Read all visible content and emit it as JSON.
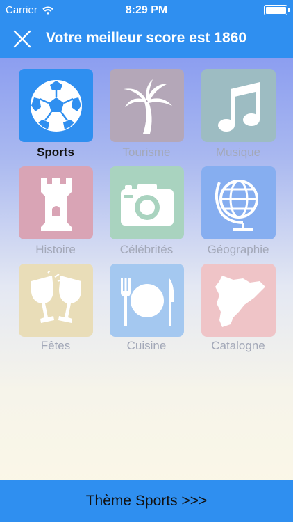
{
  "status_bar": {
    "carrier": "Carrier",
    "time": "8:29 PM"
  },
  "header": {
    "title": "Votre meilleur score est 1860"
  },
  "categories": [
    {
      "label": "Sports",
      "icon": "soccer-ball-icon",
      "color": "#2f8ff0",
      "selected": true
    },
    {
      "label": "Tourisme",
      "icon": "palm-tree-icon",
      "color": "#b4a7b8",
      "selected": false
    },
    {
      "label": "Musique",
      "icon": "music-note-icon",
      "color": "#9dbcc2",
      "selected": false
    },
    {
      "label": "Histoire",
      "icon": "castle-tower-icon",
      "color": "#d9a4b5",
      "selected": false
    },
    {
      "label": "Célébrités",
      "icon": "camera-icon",
      "color": "#a9d3bf",
      "selected": false
    },
    {
      "label": "Géographie",
      "icon": "globe-icon",
      "color": "#86aef0",
      "selected": false
    },
    {
      "label": "Fêtes",
      "icon": "wine-glasses-icon",
      "color": "#e9ddb8",
      "selected": false
    },
    {
      "label": "Cuisine",
      "icon": "plate-cutlery-icon",
      "color": "#a4c8f0",
      "selected": false
    },
    {
      "label": "Catalogne",
      "icon": "catalonia-map-icon",
      "color": "#efc4c7",
      "selected": false
    }
  ],
  "footer": {
    "button_label": "Thème Sports >>>"
  }
}
